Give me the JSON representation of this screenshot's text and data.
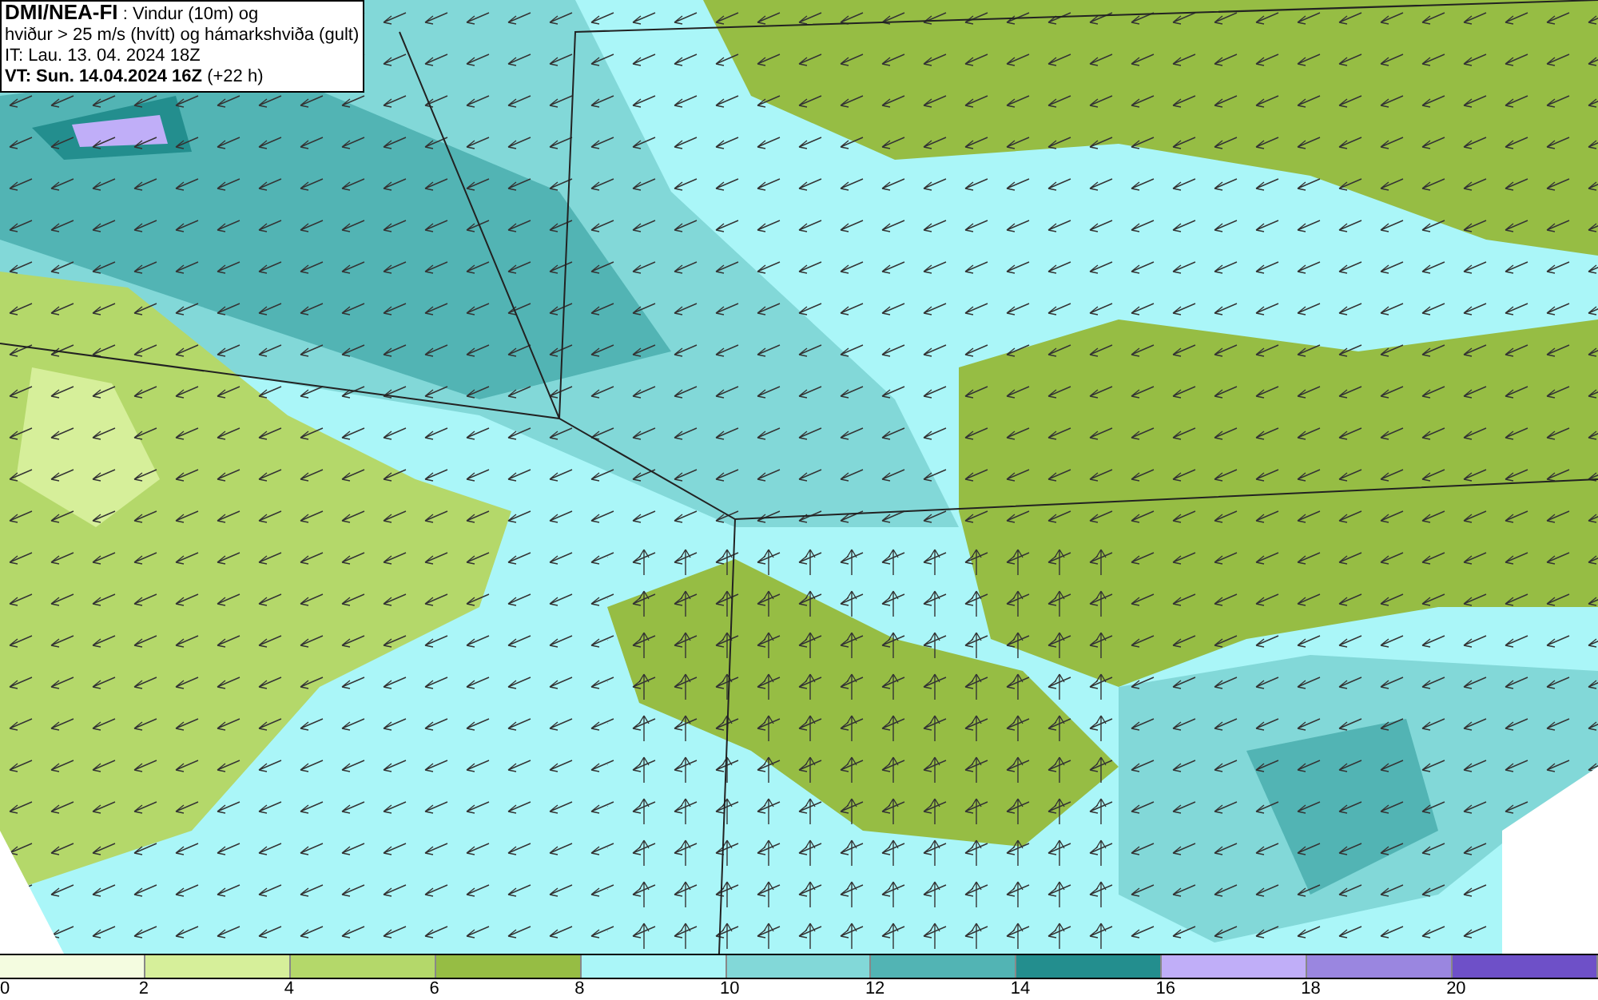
{
  "header": {
    "model": "DMI/NEA-FI",
    "title_1": ": Vindur (10m) og",
    "title_2": "hviður > 25 m/s (hvítt) og hámarkshviða (gult)",
    "issue_time": "IT: Lau. 13. 04. 2024 18Z",
    "valid_time": "VT: Sun. 14.04.2024 16Z",
    "valid_offset": "(+22 h)"
  },
  "legend": {
    "bins": [
      {
        "color": "#f4fce0"
      },
      {
        "color": "#d6ef9a"
      },
      {
        "color": "#b4d86a"
      },
      {
        "color": "#96bd44"
      },
      {
        "color": "#aaf6f8"
      },
      {
        "color": "#82d8d8"
      },
      {
        "color": "#52b4b4"
      },
      {
        "color": "#238e8e"
      },
      {
        "color": "#c0aef8"
      },
      {
        "color": "#9a86e0"
      },
      {
        "color": "#6e50c8"
      }
    ],
    "ticks": [
      "0",
      "2",
      "4",
      "6",
      "8",
      "10",
      "12",
      "14",
      "16",
      "18",
      "20"
    ]
  }
}
